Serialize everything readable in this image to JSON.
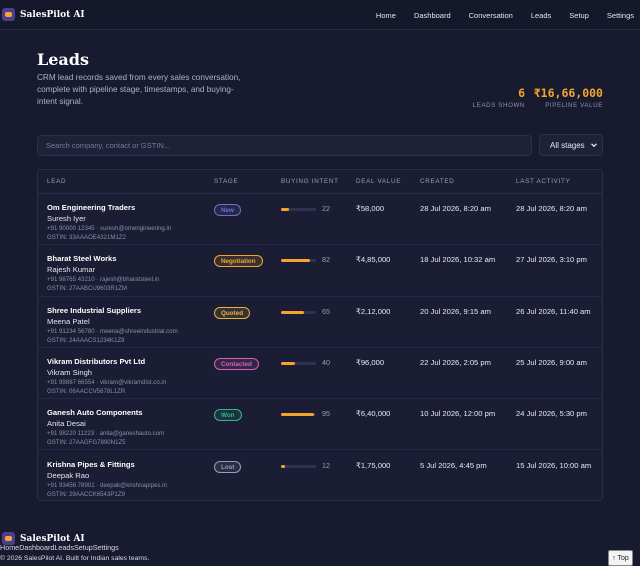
{
  "app": {
    "brand": "SalesPilot AI"
  },
  "nav": {
    "links": [
      "Home",
      "Dashboard",
      "Conversation",
      "Leads",
      "Setup",
      "Settings"
    ]
  },
  "page": {
    "title": "Leads",
    "subtitle": "CRM lead records saved from every sales conversation, complete with pipeline stage, timestamps, and buying-intent signal."
  },
  "stats": {
    "leads_count": "6",
    "leads_label": "LEADS SHOWN",
    "pipeline_value": "₹16,66,000",
    "pipeline_label": "PIPELINE VALUE"
  },
  "filters": {
    "search_placeholder": "Search company, contact or GSTIN...",
    "stage_selected": "All stages"
  },
  "table": {
    "headers": {
      "lead": "LEAD",
      "stage": "STAGE",
      "intent": "BUYING INTENT",
      "deal": "DEAL VALUE",
      "created": "CREATED",
      "last": "LAST ACTIVITY"
    },
    "rows": [
      {
        "company": "Om Engineering Traders",
        "contact": "Suresh Iyer",
        "phone_email": "+91 90000 12345 · suresh@omengineering.in",
        "gstin": "GSTIN: 33AAAOE4321M1Z2",
        "stage": "New",
        "stage_color": "#6a72c9",
        "intent": "22",
        "intent_pct": 22,
        "deal": "₹58,000",
        "created": "28 Jul 2026, 8:20 am",
        "last": "28 Jul 2026, 8:20 am"
      },
      {
        "company": "Bharat Steel Works",
        "contact": "Rajesh Kumar",
        "phone_email": "+91 98765 43210 · rajesh@bharatsteel.in",
        "gstin": "GSTIN: 27AABCU9603R1ZM",
        "stage": "Negotiation",
        "stage_color": "#f3a52c",
        "intent": "82",
        "intent_pct": 82,
        "deal": "₹4,85,000",
        "created": "18 Jul 2026, 10:32 am",
        "last": "27 Jul 2026, 3:10 pm"
      },
      {
        "company": "Shree Industrial Suppliers",
        "contact": "Meena Patel",
        "phone_email": "+91 91234 56780 · meena@shreeindustrial.com",
        "gstin": "GSTIN: 24AAACS1234K1Z8",
        "stage": "Quoted",
        "stage_color": "#e8b23a",
        "intent": "65",
        "intent_pct": 65,
        "deal": "₹2,12,000",
        "created": "20 Jul 2026, 9:15 am",
        "last": "26 Jul 2026, 11:40 am"
      },
      {
        "company": "Vikram Distributors Pvt Ltd",
        "contact": "Vikram Singh",
        "phone_email": "+91 99887 66554 · vikram@vikramdist.co.in",
        "gstin": "GSTIN: 06AACCV5678L1ZR",
        "stage": "Contacted",
        "stage_color": "#d264b8",
        "intent": "40",
        "intent_pct": 40,
        "deal": "₹96,000",
        "created": "22 Jul 2026, 2:05 pm",
        "last": "25 Jul 2026, 9:00 am"
      },
      {
        "company": "Ganesh Auto Components",
        "contact": "Anita Desai",
        "phone_email": "+91 98220 11223 · anita@ganeshauto.com",
        "gstin": "GSTIN: 27AAGFG7890N1Z5",
        "stage": "Won",
        "stage_color": "#2fb88a",
        "intent": "95",
        "intent_pct": 95,
        "deal": "₹6,40,000",
        "created": "10 Jul 2026, 12:00 pm",
        "last": "24 Jul 2026, 5:30 pm"
      },
      {
        "company": "Krishna Pipes & Fittings",
        "contact": "Deepak Rao",
        "phone_email": "+91 93456 78901 · deepak@krishnapipes.in",
        "gstin": "GSTIN: 29AACCK6543P1Z9",
        "stage": "Lost",
        "stage_color": "#9a9db7",
        "intent": "12",
        "intent_pct": 12,
        "deal": "₹1,75,000",
        "created": "5 Jul 2026, 4:45 pm",
        "last": "15 Jul 2026, 10:00 am"
      }
    ]
  },
  "footer": {
    "brand": "SalesPilot AI",
    "links": [
      "Home",
      "Dashboard",
      "Leads",
      "Setup",
      "Settings"
    ],
    "copyright": "© 2026 SalesPilot AI. Built for Indian sales teams.",
    "top_label": "↑ Top"
  }
}
